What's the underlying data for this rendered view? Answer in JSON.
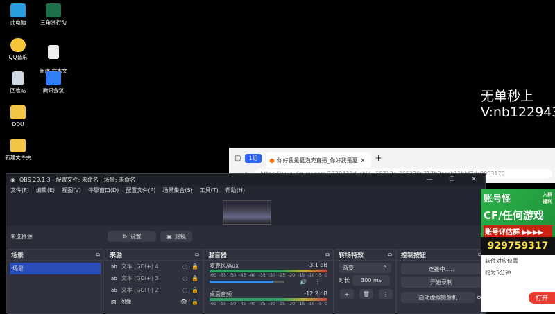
{
  "desktop": {
    "icons": [
      {
        "label": "此电脑",
        "icon": "computer-icon"
      },
      {
        "label": "三角洲行动",
        "icon": "game-icon"
      },
      {
        "label": "QQ音乐",
        "icon": "qqmusic-icon"
      },
      {
        "label": "新建 文本文\n档",
        "icon": "text-file-icon"
      },
      {
        "label": "回收站",
        "icon": "recycle-bin-icon"
      },
      {
        "label": "腾讯会议",
        "icon": "tencent-meeting-icon"
      },
      {
        "label": "DDU",
        "icon": "folder-icon"
      },
      {
        "label": "新建文件夹",
        "icon": "folder-icon"
      }
    ],
    "overlay_line1": "无单秒上",
    "overlay_line2": "V:nb122943"
  },
  "browser": {
    "tab_count_badge": "1组",
    "tab1_title": "你好我是夏泡壳直播_你好我是夏",
    "url": "https://www.douyu.com/1329432dyshid=55712e-365330e317b9accb11bbf7dc0003170"
  },
  "obs": {
    "title": "OBS 29.1.3 - 配置文件: 未命名 - 场景: 未命名",
    "menu": [
      "文件(F)",
      "编辑(E)",
      "视图(V)",
      "停靠窗口(D)",
      "配置文件(P)",
      "场景集合(S)",
      "工具(T)",
      "帮助(H)"
    ],
    "no_source": "未选择源",
    "settings_label": "设置",
    "filter_label": "滤镜",
    "docks": {
      "scenes": {
        "title": "场景",
        "items": [
          "场景"
        ]
      },
      "sources": {
        "title": "来源",
        "items": [
          "文本 (GDI+) 4",
          "文本 (GDI+) 3",
          "文本 (GDI+) 2",
          "图像"
        ]
      },
      "mixer": {
        "title": "混音器",
        "channels": [
          {
            "name": "麦克风/Aux",
            "db": "-3.1 dB",
            "level": 0.85
          },
          {
            "name": "桌面音频",
            "db": "-12.2 dB",
            "level": 0.65
          }
        ],
        "scale": [
          "-60",
          "-55",
          "-50",
          "-45",
          "-40",
          "-35",
          "-30",
          "-25",
          "-20",
          "-15",
          "-10",
          "-5",
          "0"
        ]
      },
      "transitions": {
        "title": "转场特效",
        "selected": "渐变",
        "duration_label": "时长",
        "duration": "300 ms"
      },
      "controls": {
        "title": "控制按钮",
        "connecting": "连接中.....",
        "record": "开始录制",
        "virtual_cam": "启动虚拟摄像机"
      }
    }
  },
  "ad": {
    "brand": "账号怪",
    "line1": "CF/任何游戏",
    "line2": "账号评估群 ▶▶▶▶",
    "number": "929759317",
    "tag": "入群\n福利",
    "sub1": "软件对应位置",
    "sub2": "约为5分钟",
    "open_btn": "打开"
  }
}
